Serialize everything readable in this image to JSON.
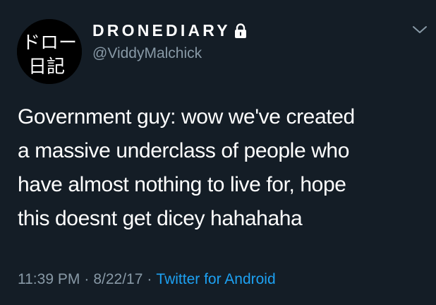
{
  "tweet": {
    "author": {
      "display_name": "DRONEDIARY",
      "handle": "@ViddyMalchick",
      "avatar_text": [
        "ドロー",
        "日記"
      ],
      "protected_icon": "lock-icon"
    },
    "menu_icon": "chevron-down-icon",
    "text_lines": [
      "Government guy: wow we've created",
      "a massive underclass of people who",
      "have almost nothing to live for, hope",
      "this doesnt get dicey hahahaha"
    ],
    "time": "11:39 PM",
    "separator": "·",
    "date": "8/22/17",
    "source": "Twitter for Android"
  },
  "colors": {
    "background": "#141d26",
    "text": "#ffffff",
    "secondary": "#8899a6",
    "link": "#1da1f2"
  }
}
